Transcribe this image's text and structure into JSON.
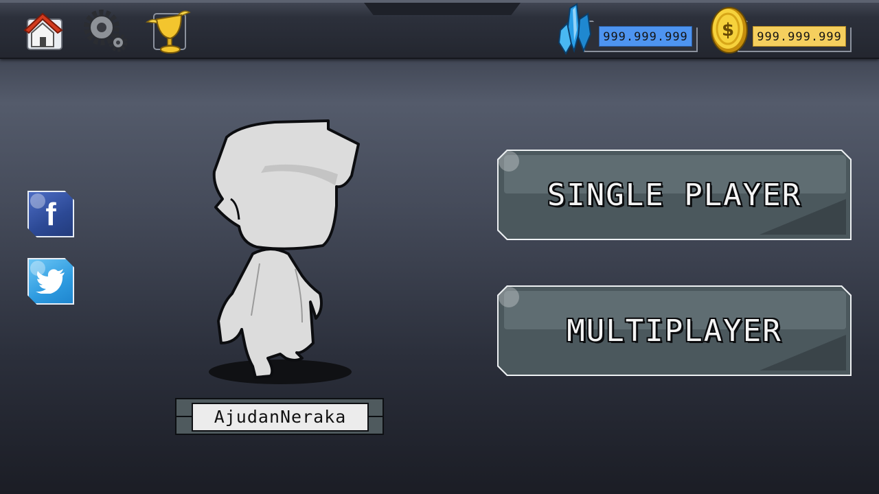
{
  "top_bar": {
    "icons": [
      "home-icon",
      "settings-gears-icon",
      "trophy-icon"
    ]
  },
  "currency": {
    "gems": {
      "icon": "blue-crystal-icon",
      "value": "999.999.999",
      "color": "#4e94f0"
    },
    "coins": {
      "icon": "gold-coin-icon",
      "value": "999.999.999",
      "color": "#f5cf5e"
    }
  },
  "social": {
    "facebook": {
      "icon": "facebook-icon",
      "color": "#2c4995"
    },
    "twitter": {
      "icon": "twitter-bird-icon",
      "color": "#2e9be0"
    }
  },
  "player": {
    "avatar": "character-avatar",
    "name": "AjudanNeraka"
  },
  "menu": {
    "single_player": "SINGLE PLAYER",
    "multiplayer": "MULTIPLAYER"
  }
}
